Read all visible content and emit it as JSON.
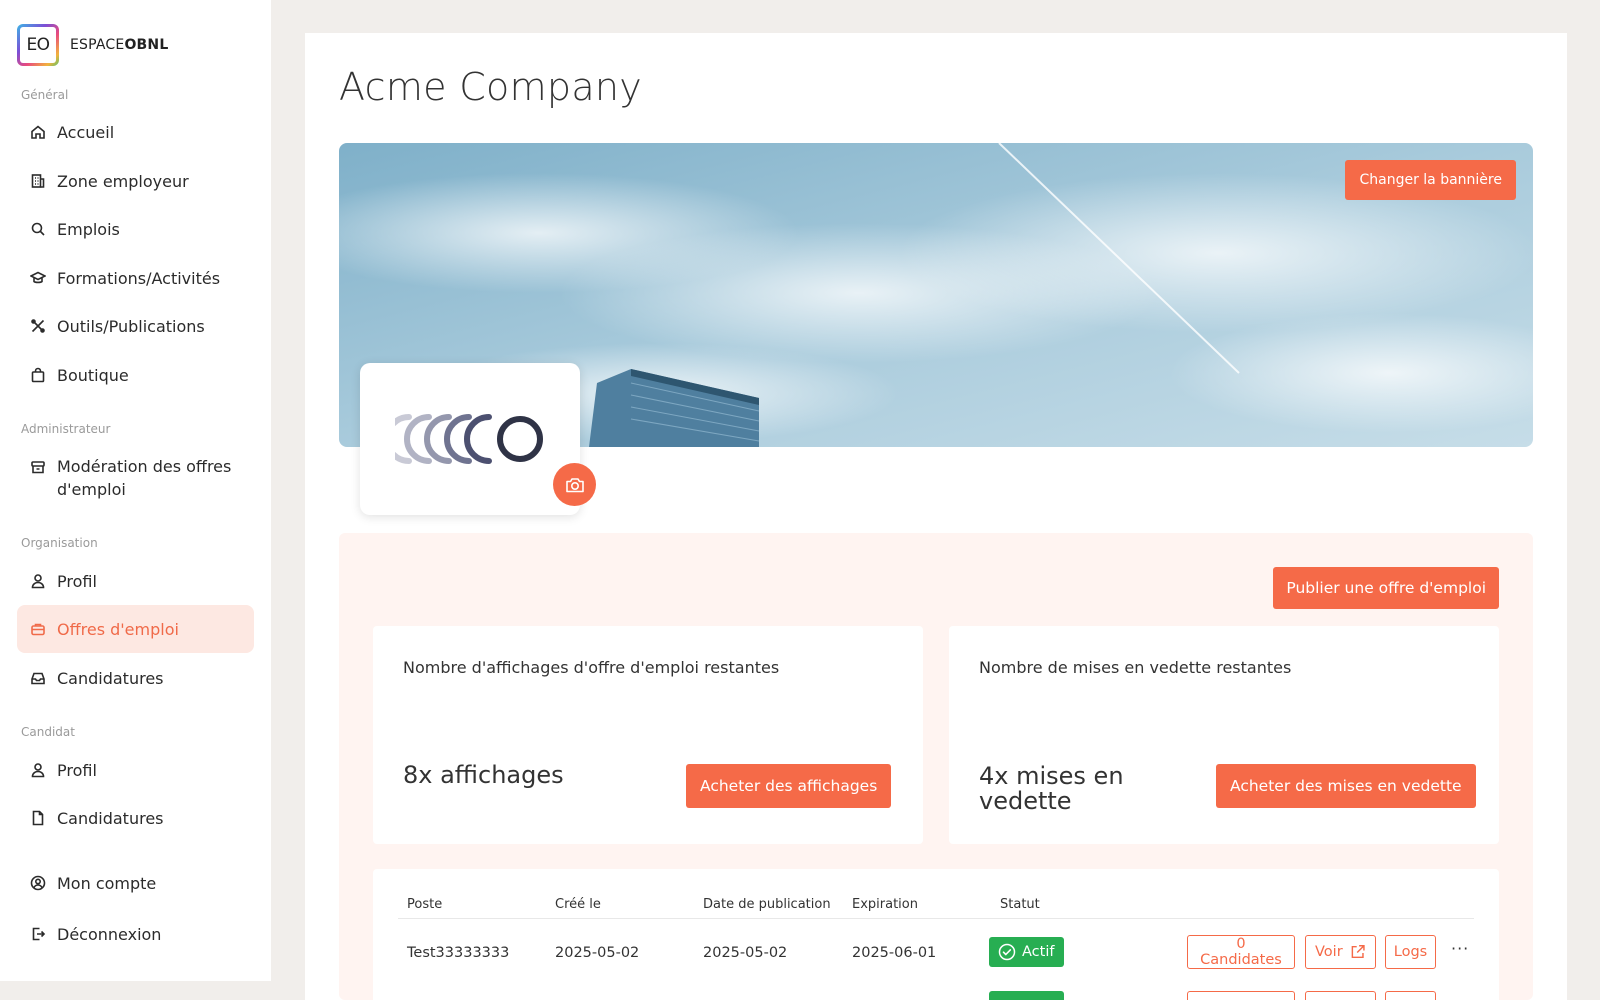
{
  "logo": {
    "mark": "EO",
    "text_light": "ESPACE",
    "text_bold": "OBNL"
  },
  "sidebar": {
    "general_label": "Général",
    "general": [
      {
        "label": "Accueil",
        "icon": "home-icon"
      },
      {
        "label": "Zone employeur",
        "icon": "building-icon"
      },
      {
        "label": "Emplois",
        "icon": "search-icon"
      },
      {
        "label": "Formations/Activités",
        "icon": "graduation-cap-icon"
      },
      {
        "label": "Outils/Publications",
        "icon": "tools-icon"
      },
      {
        "label": "Boutique",
        "icon": "shopping-bag-icon"
      }
    ],
    "admin_label": "Administrateur",
    "admin": [
      {
        "label_line1": "Modération des offres",
        "label_line2": "d'emploi",
        "icon": "archive-icon"
      }
    ],
    "org_label": "Organisation",
    "org": [
      {
        "label": "Profil",
        "icon": "user-icon"
      },
      {
        "label": "Offres d'emploi",
        "icon": "briefcase-icon",
        "active": true
      },
      {
        "label": "Candidatures",
        "icon": "inbox-icon"
      }
    ],
    "candidate_label": "Candidat",
    "candidate": [
      {
        "label": "Profil",
        "icon": "user-icon"
      },
      {
        "label": "Candidatures",
        "icon": "file-icon"
      }
    ],
    "account": {
      "label": "Mon compte",
      "icon": "user-circle-icon"
    },
    "logout": {
      "label": "Déconnexion",
      "icon": "logout-icon"
    }
  },
  "page": {
    "title": "Acme Company",
    "change_banner": "Changer la bannière",
    "publish": "Publier une offre d'emploi"
  },
  "stats": {
    "postings": {
      "label": "Nombre d'affichages d'offre d'emploi restantes",
      "value": "8x affichages",
      "button": "Acheter des affichages"
    },
    "featured": {
      "label": "Nombre de mises en vedette restantes",
      "value_line1": "4x mises en",
      "value_line2": "vedette",
      "button": "Acheter des mises en vedette"
    }
  },
  "table": {
    "headers": [
      "Poste",
      "Créé le",
      "Date de publication",
      "Expiration",
      "Statut"
    ],
    "rows": [
      {
        "poste": "Test33333333",
        "cree": "2025-05-02",
        "publication": "2025-05-02",
        "expiration": "2025-06-01",
        "statut": "Actif",
        "candidates": "0 Candidates",
        "voir": "Voir",
        "logs": "Logs",
        "more": "···"
      }
    ]
  },
  "colors": {
    "accent": "#f56a48",
    "accent_soft": "#fde8e2",
    "success": "#27ae52",
    "peach_bg": "#fff4f1"
  }
}
